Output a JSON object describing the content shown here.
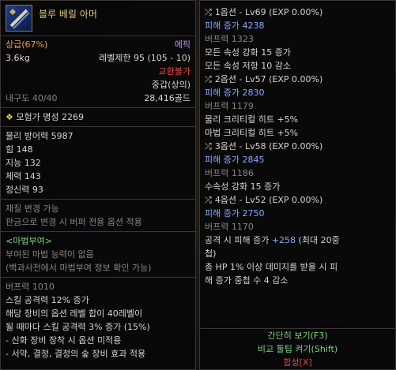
{
  "item": {
    "name": "블루 베릴 아머",
    "grade": "상급(67%)",
    "rarity": "에픽",
    "weight": "3.6kg",
    "level_limit": "레벨제한 95 (105 - 10)",
    "trade": "교환불가",
    "armor_type": "중갑(상의)",
    "durability": "내구도 40/40",
    "price": "28,416골드",
    "fame": "모험가 명성 2269"
  },
  "stats": [
    "물리 방어력 5987",
    "힘 148",
    "지능 132",
    "체력 143",
    "정신력 93"
  ],
  "material": {
    "line1": "재질 변경 가능",
    "line2": "판금으로 변경 시 버퍼 전용 옵션 적용"
  },
  "enchant": {
    "title": "<마법부여>",
    "line1": "부여된 마법 능력이 없음",
    "line2": "(백과사전에서 마법부여 정보 확인 가능)"
  },
  "buff": {
    "power": "버프력 1010",
    "lines": [
      "스킬 공격력 12% 증가",
      "해당 장비의 옵션 레벨 합이 40레벨이",
      "될 때마다 스킬 공격력 3% 증가 (15%)",
      "- 신화 장비 장착 시 옵션 미적용",
      "- 서약, 결정, 결정의 숲 장비 효과 적용"
    ]
  },
  "options": [
    {
      "title": "1옵션 - Lv69 (EXP 0.00%)",
      "dmg": "피해 증가 4238",
      "buff": "버프력 1323",
      "effects": [
        "모든 속성 강화 15 증가",
        "모든 속성 저항 10 감소"
      ]
    },
    {
      "title": "2옵션 - Lv57 (EXP 0.00%)",
      "dmg": "피해 증가 2830",
      "buff": "버프력 1179",
      "effects": [
        "물리 크리티컬 히트 +5%",
        "마법 크리티컬 히트 +5%"
      ]
    },
    {
      "title": "3옵션 - Lv58 (EXP 0.00%)",
      "dmg": "피해 증가 2845",
      "buff": "버프력 1186",
      "effects": [
        "수속성 강화 15 증가"
      ]
    },
    {
      "title": "4옵션 - Lv52 (EXP 0.00%)",
      "dmg": "피해 증가 2750",
      "buff": "버프력 1170",
      "effects": [
        "공격 시 피해 증가 +258 (최대 20중",
        "첩)",
        "총 HP 1% 이상 데미지를 받을 시 피",
        "해 증가 중첩 수 4 감소"
      ]
    }
  ],
  "buttons": {
    "simple": "간단히 보기(F3)",
    "compare": "비교 툴팁 켜기(Shift)",
    "combine": "합성[X]"
  },
  "icons": {
    "item": "armor-icon",
    "fame": "fame-badge-icon",
    "option": "shuffle-icon"
  }
}
